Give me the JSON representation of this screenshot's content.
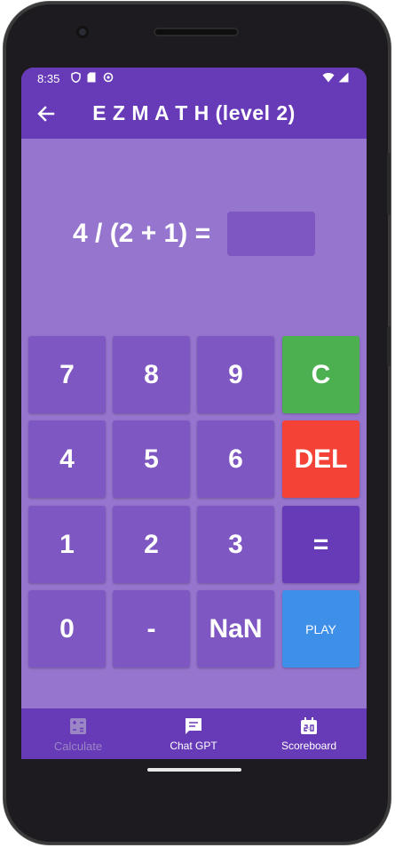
{
  "status": {
    "time": "8:35"
  },
  "appbar": {
    "title": "E Z M A T H (level 2)"
  },
  "question": {
    "text": "4 / (2 + 1) =",
    "answer_value": ""
  },
  "keypad": {
    "keys": [
      "7",
      "8",
      "9",
      "C",
      "4",
      "5",
      "6",
      "DEL",
      "1",
      "2",
      "3",
      "=",
      "0",
      "-",
      "NaN",
      "PLAY"
    ]
  },
  "nav": {
    "items": [
      {
        "label": "Calculate",
        "icon": "calculator-icon"
      },
      {
        "label": "Chat GPT",
        "icon": "chat-icon"
      },
      {
        "label": "Scoreboard",
        "icon": "scoreboard-icon"
      }
    ]
  },
  "colors": {
    "primary": "#673ab7",
    "background": "#9575cd",
    "key": "#7e57c2",
    "clear": "#4caf50",
    "delete": "#f44336",
    "play": "#3d8fe8"
  }
}
